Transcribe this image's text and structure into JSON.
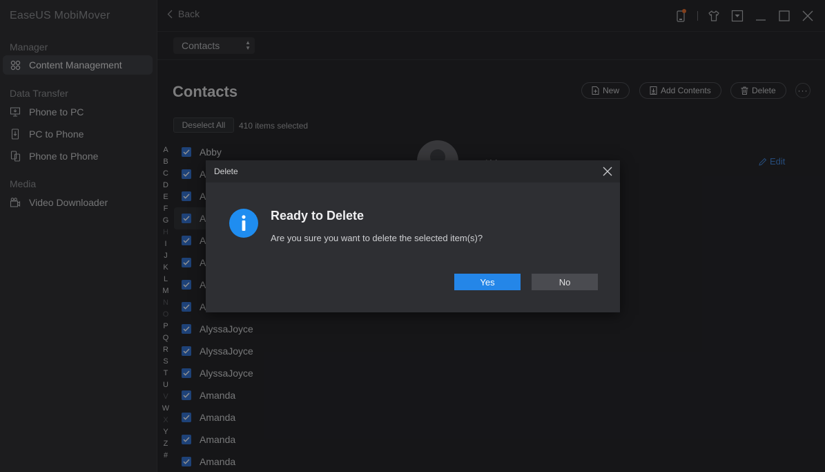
{
  "app": {
    "title": "EaseUS MobiMover"
  },
  "sidebar": {
    "sections": [
      {
        "label": "Manager"
      },
      {
        "label": "Data Transfer"
      },
      {
        "label": "Media"
      }
    ],
    "items": [
      {
        "label": "Content Management",
        "icon": "grid-icon",
        "active": true
      },
      {
        "label": "Phone to PC",
        "icon": "phone-to-pc-icon"
      },
      {
        "label": "PC to Phone",
        "icon": "pc-to-phone-icon"
      },
      {
        "label": "Phone to Phone",
        "icon": "phone-to-phone-icon"
      },
      {
        "label": "Video Downloader",
        "icon": "video-downloader-icon"
      }
    ]
  },
  "topbar": {
    "back_label": "Back"
  },
  "category_select": {
    "value": "Contacts"
  },
  "main": {
    "title": "Contacts",
    "toolbar": {
      "new_label": "New",
      "add_contents_label": "Add Contents",
      "delete_label": "Delete",
      "more_label": "···"
    },
    "deselect_label": "Deselect All",
    "selection_count": "410 items selected",
    "alphabet": [
      "A",
      "B",
      "C",
      "D",
      "E",
      "F",
      "G",
      "H",
      "I",
      "J",
      "K",
      "L",
      "M",
      "N",
      "O",
      "P",
      "Q",
      "R",
      "S",
      "T",
      "U",
      "V",
      "W",
      "X",
      "Y",
      "Z",
      "#"
    ],
    "alphabet_dim": [
      "H",
      "N",
      "O",
      "V",
      "X"
    ],
    "contacts": [
      "Abby",
      "A",
      "A",
      "A",
      "A",
      "A",
      "A",
      "A",
      "AlyssaJoyce",
      "AlyssaJoyce",
      "AlyssaJoyce",
      "Amanda",
      "Amanda",
      "Amanda",
      "Amanda"
    ],
    "detail": {
      "edit_label": "Edit"
    }
  },
  "dialog": {
    "header": "Delete",
    "title": "Ready to Delete",
    "message": "Are you sure you want to delete the selected item(s)?",
    "yes_label": "Yes",
    "no_label": "No"
  },
  "colors": {
    "accent": "#2486e8",
    "checkbox": "#2f6fd1",
    "info": "#1f8df0",
    "link": "#3d82d8"
  }
}
